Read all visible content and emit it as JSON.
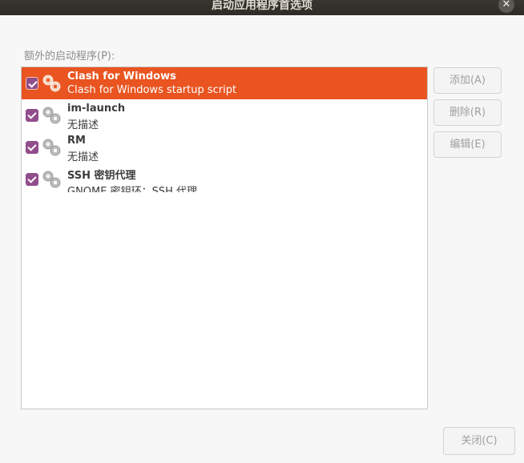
{
  "window": {
    "title": "启动应用程序首选项",
    "close_glyph": "✕"
  },
  "section_label": "额外的启动程序(P):",
  "startup_programs": [
    {
      "name": "Clash for Windows",
      "description": "Clash for Windows startup script",
      "checked": true,
      "selected": true,
      "icon": "gears-icon"
    },
    {
      "name": "im-launch",
      "description": "无描述",
      "checked": true,
      "selected": false,
      "icon": "gears-icon"
    },
    {
      "name": "RM",
      "description": "无描述",
      "checked": true,
      "selected": false,
      "icon": "gears-icon"
    },
    {
      "name": "SSH 密钥代理",
      "description": "GNOME 密钥环：SSH 代理",
      "checked": true,
      "selected": false,
      "icon": "gears-icon"
    }
  ],
  "buttons": {
    "add": "添加(A)",
    "remove": "删除(R)",
    "edit": "编辑(E)",
    "close": "关闭(C)"
  },
  "colors": {
    "selection": "#e95420",
    "checkbox": "#924d8b",
    "titlebar": "#2d2c28"
  }
}
